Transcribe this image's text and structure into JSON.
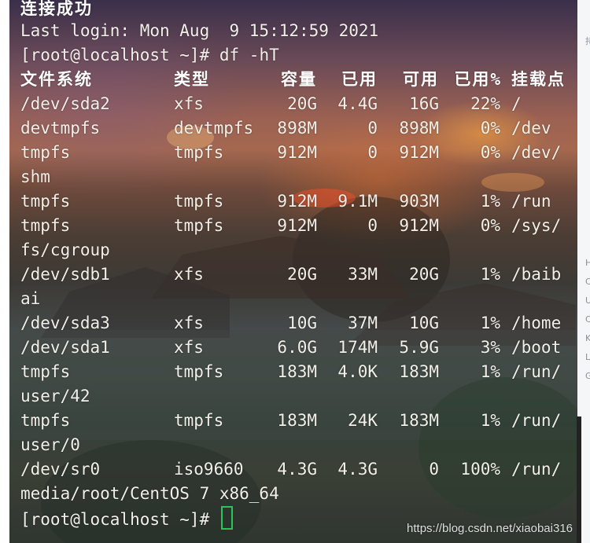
{
  "terminal": {
    "connected_message": "连接成功",
    "last_login": "Last login: Mon Aug  9 15:12:59 2021",
    "prompt": "[root@localhost ~]# ",
    "command": "df -hT",
    "headers": {
      "filesystem": "文件系统",
      "type": "类型",
      "size": "容量",
      "used": "已用",
      "avail": "可用",
      "use_pct": "已用%",
      "mounted_on": "挂载点"
    },
    "rows": [
      {
        "fs": "/dev/sda2",
        "type": "xfs",
        "size": "20G",
        "used": "4.4G",
        "avail": "16G",
        "pct": "22%",
        "mount": "/",
        "wrap": ""
      },
      {
        "fs": "devtmpfs",
        "type": "devtmpfs",
        "size": "898M",
        "used": "0",
        "avail": "898M",
        "pct": "0%",
        "mount": "/dev",
        "wrap": ""
      },
      {
        "fs": "tmpfs",
        "type": "tmpfs",
        "size": "912M",
        "used": "0",
        "avail": "912M",
        "pct": "0%",
        "mount": "/dev/",
        "wrap": "shm"
      },
      {
        "fs": "tmpfs",
        "type": "tmpfs",
        "size": "912M",
        "used": "9.1M",
        "avail": "903M",
        "pct": "1%",
        "mount": "/run",
        "wrap": ""
      },
      {
        "fs": "tmpfs",
        "type": "tmpfs",
        "size": "912M",
        "used": "0",
        "avail": "912M",
        "pct": "0%",
        "mount": "/sys/",
        "wrap": "fs/cgroup"
      },
      {
        "fs": "/dev/sdb1",
        "type": "xfs",
        "size": "20G",
        "used": "33M",
        "avail": "20G",
        "pct": "1%",
        "mount": "/baib",
        "wrap": "ai"
      },
      {
        "fs": "/dev/sda3",
        "type": "xfs",
        "size": "10G",
        "used": "37M",
        "avail": "10G",
        "pct": "1%",
        "mount": "/home",
        "wrap": ""
      },
      {
        "fs": "/dev/sda1",
        "type": "xfs",
        "size": "6.0G",
        "used": "174M",
        "avail": "5.9G",
        "pct": "3%",
        "mount": "/boot",
        "wrap": ""
      },
      {
        "fs": "tmpfs",
        "type": "tmpfs",
        "size": "183M",
        "used": "4.0K",
        "avail": "183M",
        "pct": "1%",
        "mount": "/run/",
        "wrap": "user/42"
      },
      {
        "fs": "tmpfs",
        "type": "tmpfs",
        "size": "183M",
        "used": "24K",
        "avail": "183M",
        "pct": "1%",
        "mount": "/run/",
        "wrap": "user/0"
      },
      {
        "fs": "/dev/sr0",
        "type": "iso9660",
        "size": "4.3G",
        "used": "4.3G",
        "avail": "0",
        "pct": "100%",
        "mount": "/run/",
        "wrap": "media/root/CentOS 7 x86_64"
      }
    ],
    "final_prompt": "[root@localhost ~]# "
  },
  "right_strip_chars": [
    "持",
    "H",
    "C",
    "U",
    "C",
    "K",
    "L",
    "G"
  ],
  "watermark": "https://blog.csdn.net/xiaobai316",
  "colors": {
    "text": "#f2efe9",
    "cursor": "#29c45a"
  }
}
